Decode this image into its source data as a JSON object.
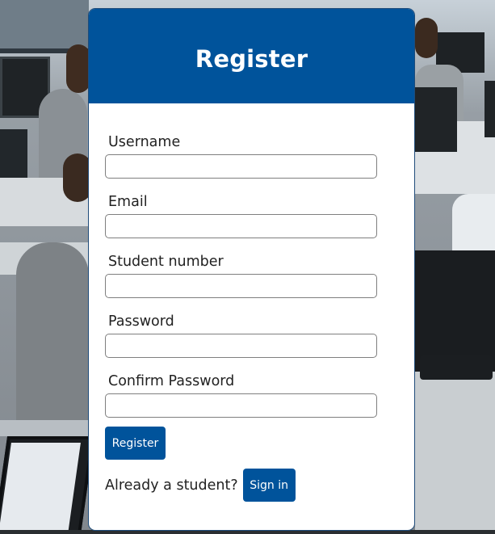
{
  "form": {
    "title": "Register",
    "fields": [
      {
        "label": "Username",
        "value": "",
        "placeholder": ""
      },
      {
        "label": "Email",
        "value": "",
        "placeholder": ""
      },
      {
        "label": "Student number",
        "value": "",
        "placeholder": ""
      },
      {
        "label": "Password",
        "value": "",
        "placeholder": ""
      },
      {
        "label": "Confirm Password",
        "value": "",
        "placeholder": ""
      }
    ],
    "register_label": "Register",
    "already_text": "Already a student?",
    "signin_label": "Sign in"
  },
  "colors": {
    "primary": "#00539b",
    "card_bg": "#ffffff",
    "input_border": "#7f7f7f"
  }
}
